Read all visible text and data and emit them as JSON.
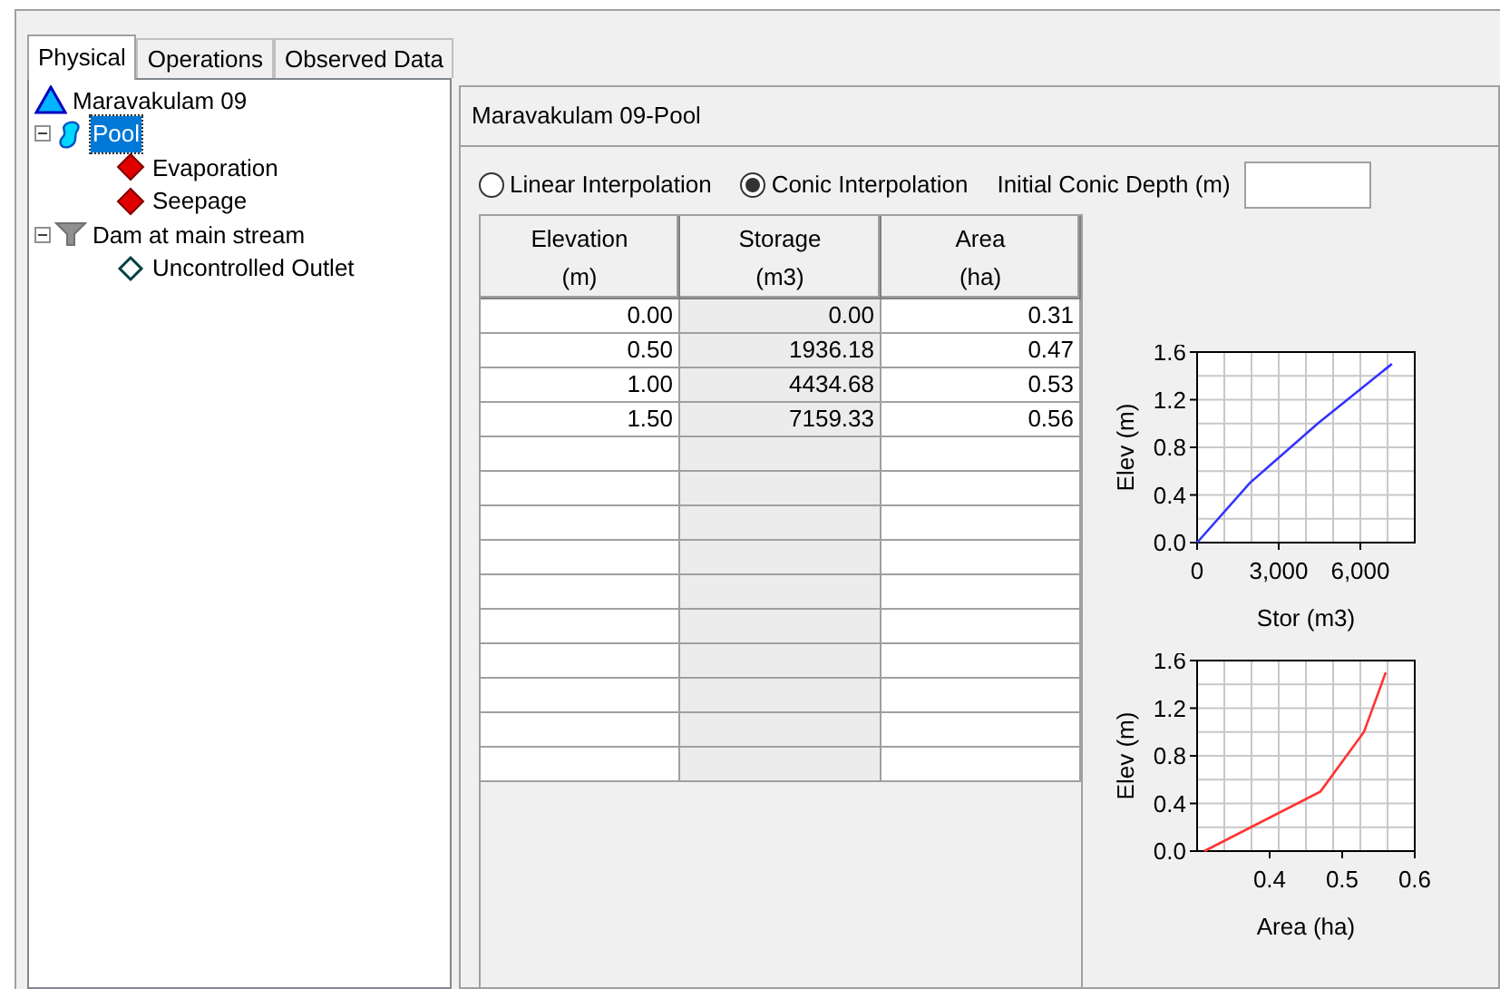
{
  "tabs": [
    {
      "label": "Physical",
      "selected": true
    },
    {
      "label": "Operations",
      "selected": false
    },
    {
      "label": "Observed Data",
      "selected": false
    }
  ],
  "tree": [
    {
      "label": "Maravakulam 09",
      "kind": "reservoir",
      "selected": false,
      "children": [
        {
          "label": "Pool",
          "kind": "pool",
          "selected": true,
          "expanded": true,
          "children": [
            {
              "label": "Evaporation",
              "kind": "loss",
              "selected": false
            },
            {
              "label": "Seepage",
              "kind": "loss",
              "selected": false
            }
          ]
        },
        {
          "label": "Dam at main stream",
          "kind": "dam",
          "selected": false,
          "expanded": true,
          "children": [
            {
              "label": "Uncontrolled Outlet",
              "kind": "outlet",
              "selected": false
            }
          ]
        }
      ]
    }
  ],
  "panel": {
    "title": "Maravakulam 09-Pool",
    "options": [
      {
        "label": "Linear Interpolation",
        "selected": false
      },
      {
        "label": "Conic Interpolation",
        "selected": true
      }
    ],
    "depth_field": {
      "label": "Initial Conic Depth (m)"
    },
    "table": {
      "columns": [
        "Elevation\n(m)",
        "Storage\n(m3)",
        "Area\n(ha)"
      ],
      "rows": [
        [
          "0.00",
          "0.00",
          "0.31"
        ],
        [
          "0.50",
          "1936.18",
          "0.47"
        ],
        [
          "1.00",
          "4434.68",
          "0.53"
        ],
        [
          "1.50",
          "7159.33",
          "0.56"
        ]
      ]
    },
    "charts": [
      {
        "chart_data": {
          "type": "line",
          "xlabel": "Stor (m3)",
          "ylabel": "Elev (m)",
          "xlim": [
            0,
            8000
          ],
          "ylim": [
            0,
            1.6
          ],
          "x": [
            0,
            1936.18,
            4434.68,
            7159.33
          ],
          "grid": true,
          "series": [
            {
              "color": "#3333ff",
              "values": [
                0,
                0.5,
                1.0,
                1.5
              ]
            }
          ],
          "xticks": [
            {
              "value": 0,
              "label": "0"
            },
            {
              "value": 3000,
              "label": "3,000"
            },
            {
              "value": 6000,
              "label": "6,000"
            }
          ],
          "yticks": [
            {
              "value": 0,
              "label": "0.0"
            },
            {
              "value": 0.4,
              "label": "0.4"
            },
            {
              "value": 0.8,
              "label": "0.8"
            },
            {
              "value": 1.2,
              "label": "1.2"
            },
            {
              "value": 1.6,
              "label": "1.6"
            }
          ]
        }
      },
      {
        "chart_data": {
          "type": "line",
          "xlabel": "Area (ha)",
          "ylabel": "Elev (m)",
          "xlim": [
            0.3,
            0.6
          ],
          "ylim": [
            0,
            1.6
          ],
          "x": [
            0.31,
            0.47,
            0.53,
            0.56
          ],
          "grid": true,
          "series": [
            {
              "color": "#ff3333",
              "values": [
                0,
                0.5,
                1.0,
                1.5
              ]
            }
          ],
          "xticks": [
            0.4,
            0.5,
            0.6
          ],
          "yticks": [
            {
              "value": 0,
              "label": "0.0"
            },
            {
              "value": 0.4,
              "label": "0.4"
            },
            {
              "value": 0.8,
              "label": "0.8"
            },
            {
              "value": 1.2,
              "label": "1.2"
            },
            {
              "value": 1.6,
              "label": "1.6"
            }
          ]
        }
      }
    ]
  }
}
